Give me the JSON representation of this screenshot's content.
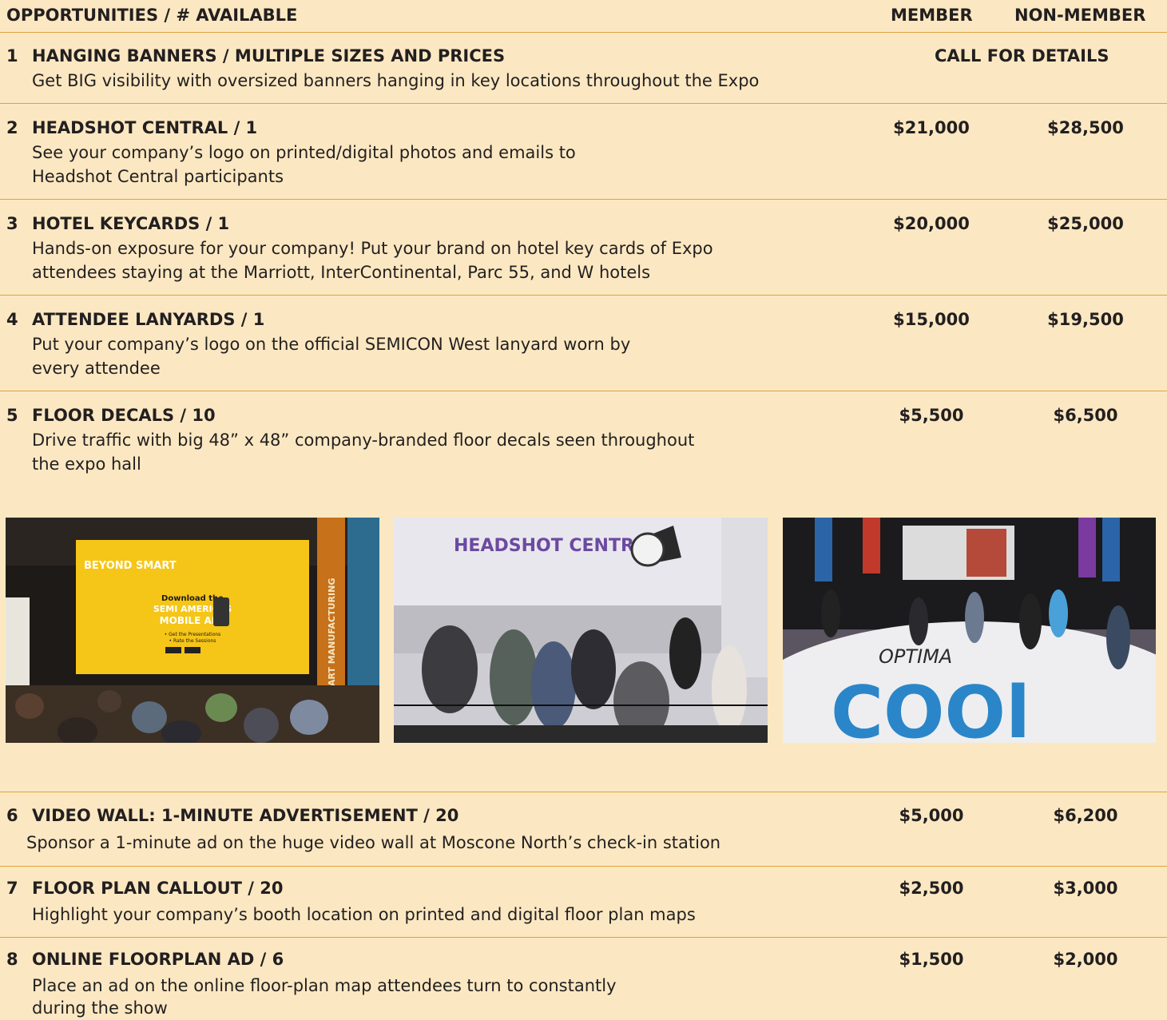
{
  "header": {
    "col_opportunities": "OPPORTUNITIES / # AVAILABLE",
    "col_member": "MEMBER",
    "col_nonmember": "NON-MEMBER"
  },
  "rows": [
    {
      "num": "1",
      "title": "HANGING BANNERS / MULTIPLE SIZES AND PRICES",
      "desc1": "Get BIG visibility with oversized banners hanging in key locations throughout the Expo",
      "desc2": "",
      "price_call": "CALL FOR DETAILS"
    },
    {
      "num": "2",
      "title": "HEADSHOT CENTRAL / 1",
      "desc1": "See your company’s logo on printed/digital photos and emails to",
      "desc2": "Headshot Central participants",
      "member": "$21,000",
      "nonmember": "$28,500"
    },
    {
      "num": "3",
      "title": "HOTEL KEYCARDS / 1",
      "desc1": "Hands-on exposure for your company! Put your brand on hotel key cards of Expo",
      "desc2": "attendees staying at the Marriott, InterContinental, Parc 55, and W hotels",
      "member": "$20,000",
      "nonmember": "$25,000"
    },
    {
      "num": "4",
      "title": "ATTENDEE LANYARDS  / 1",
      "desc1": "Put your company’s logo on the official SEMICON West lanyard worn by",
      "desc2": "every attendee",
      "member": "$15,000",
      "nonmember": "$19,500"
    },
    {
      "num": "5",
      "title": "FLOOR DECALS / 10",
      "desc1": "Drive traffic with big 48” x 48” company-branded floor decals seen throughout",
      "desc2": "the expo hall",
      "member": "$5,500",
      "nonmember": "$6,500"
    },
    {
      "num": "6",
      "title": "VIDEO WALL: 1-MINUTE ADVERTISEMENT / 20",
      "desc1": "Sponsor a 1-minute ad on the huge video wall at Moscone North’s check-in station",
      "desc2": "",
      "member": "$5,000",
      "nonmember": "$6,200"
    },
    {
      "num": "7",
      "title": "FLOOR PLAN CALLOUT  / 20",
      "desc1": "Highlight your company’s booth location on printed and digital floor plan maps",
      "desc2": "",
      "member": "$2,500",
      "nonmember": "$3,000"
    },
    {
      "num": "8",
      "title": "ONLINE FLOORPLAN AD / 6",
      "desc1": "Place an ad on the online floor-plan map attendees turn to constantly",
      "desc2": "during the show",
      "member": "$1,500",
      "nonmember": "$2,000"
    }
  ],
  "photos": {
    "photo1": {
      "screen_brand": "BEYOND SMART",
      "screen_line1": "Download the",
      "screen_line2": "SEMI AMERICAS",
      "screen_line3": "MOBILE APP",
      "screen_bullet1": "• Get the Presentations",
      "screen_bullet2": "• Rate the Sessions",
      "banner_text": "SMART MANUFACTURING"
    },
    "photo2": {
      "wall_text": "HEADSHOT CENTRAL"
    },
    "photo3": {
      "decal_top": "OPTIMA",
      "decal_big": "COOl"
    }
  },
  "colors": {
    "background": "#fbe8c2",
    "divider": "#e0a23c",
    "text": "#231f20"
  }
}
